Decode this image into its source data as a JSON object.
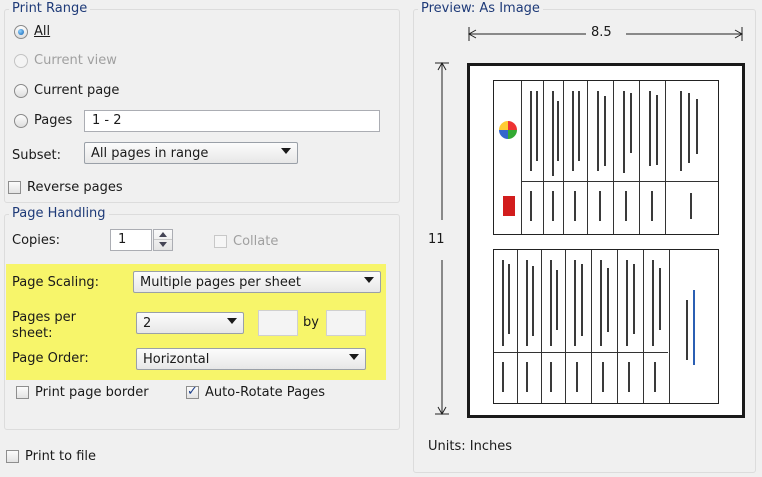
{
  "print_range": {
    "title": "Print Range",
    "all_label": "All",
    "current_view_label": "Current view",
    "current_page_label": "Current page",
    "pages_label": "Pages",
    "pages_value": "1 - 2",
    "subset_label": "Subset:",
    "subset_value": "All pages in range",
    "reverse_label": "Reverse pages"
  },
  "page_handling": {
    "title": "Page Handling",
    "copies_label": "Copies:",
    "copies_value": "1",
    "collate_label": "Collate",
    "scaling_label": "Page Scaling:",
    "scaling_value": "Multiple pages per sheet",
    "pages_per_sheet_label": "Pages per sheet:",
    "pages_per_sheet_value": "2",
    "by_label": "by",
    "page_order_label": "Page Order:",
    "page_order_value": "Horizontal",
    "print_border_label": "Print page border",
    "auto_rotate_label": "Auto-Rotate Pages"
  },
  "print_to_file_label": "Print to file",
  "preview": {
    "title": "Preview: As Image",
    "width_label": "8.5",
    "height_label": "11",
    "units_label": "Units: Inches"
  },
  "colors": {
    "highlight": "#f7f56a",
    "title_blue": "#1e3a78"
  }
}
